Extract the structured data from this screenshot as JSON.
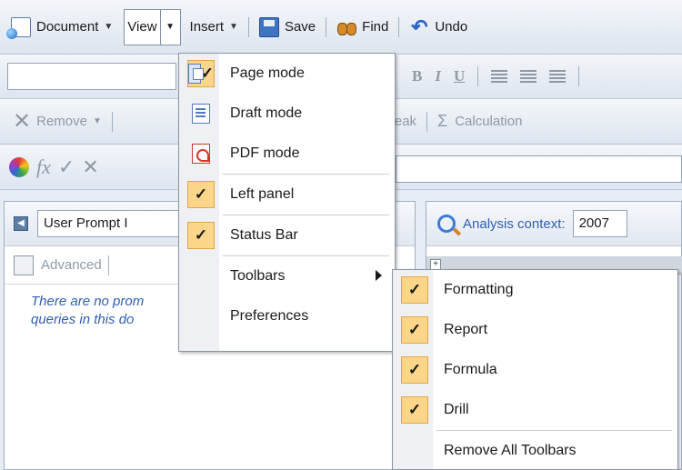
{
  "toolbar": {
    "document_label": "Document",
    "view_label": "View",
    "insert_label": "Insert",
    "save_label": "Save",
    "find_label": "Find",
    "undo_label": "Undo"
  },
  "formatting_bar": {
    "bold": "B",
    "italic": "I",
    "underline": "U"
  },
  "report_bar": {
    "remove_label": "Remove",
    "break_label": "Break",
    "calculation_label": "Calculation",
    "sigma": "Σ"
  },
  "formula_bar": {
    "fx": "fx"
  },
  "left_panel": {
    "prompt_combo": "User Prompt I",
    "advanced_label": "Advanced",
    "message": "There are no prom queries in this do"
  },
  "right_panel": {
    "context_label": "Analysis context:",
    "context_value": "2007"
  },
  "view_menu": {
    "items": [
      {
        "label": "Page mode",
        "icon": "page-mode-icon"
      },
      {
        "label": "Draft mode",
        "icon": "draft-mode-icon"
      },
      {
        "label": "PDF mode",
        "icon": "pdf-mode-icon"
      },
      {
        "label": "Left panel",
        "checked": true
      },
      {
        "label": "Status Bar",
        "checked": true
      },
      {
        "label": "Toolbars",
        "has_submenu": true
      },
      {
        "label": "Preferences"
      }
    ]
  },
  "toolbars_submenu": {
    "items": [
      {
        "label": "Formatting",
        "checked": true
      },
      {
        "label": "Report",
        "checked": true
      },
      {
        "label": "Formula",
        "checked": true
      },
      {
        "label": "Drill",
        "checked": true
      },
      {
        "label": "Remove All Toolbars"
      }
    ]
  },
  "colors": {
    "accent": "#2f5fb0",
    "check_highlight": "#fbd58a",
    "toolbar_bg": "#dde5ef"
  }
}
